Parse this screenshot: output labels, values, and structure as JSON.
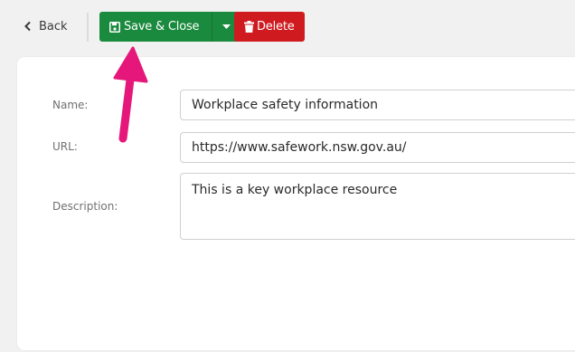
{
  "toolbar": {
    "back_label": "Back",
    "save_label": "Save & Close",
    "delete_label": "Delete"
  },
  "icons": {
    "back": "chevron-left-icon",
    "save": "floppy-disk-icon",
    "dropdown": "caret-down-icon",
    "delete": "trash-icon"
  },
  "colors": {
    "save": "#1a8a3e",
    "delete": "#cf1b20",
    "annotation_arrow": "#e5177a"
  },
  "form": {
    "name": {
      "label": "Name:",
      "value": "Workplace safety information"
    },
    "url": {
      "label": "URL:",
      "value": "https://www.safework.nsw.gov.au/"
    },
    "description": {
      "label": "Description:",
      "value": "This is a key workplace resource"
    }
  }
}
